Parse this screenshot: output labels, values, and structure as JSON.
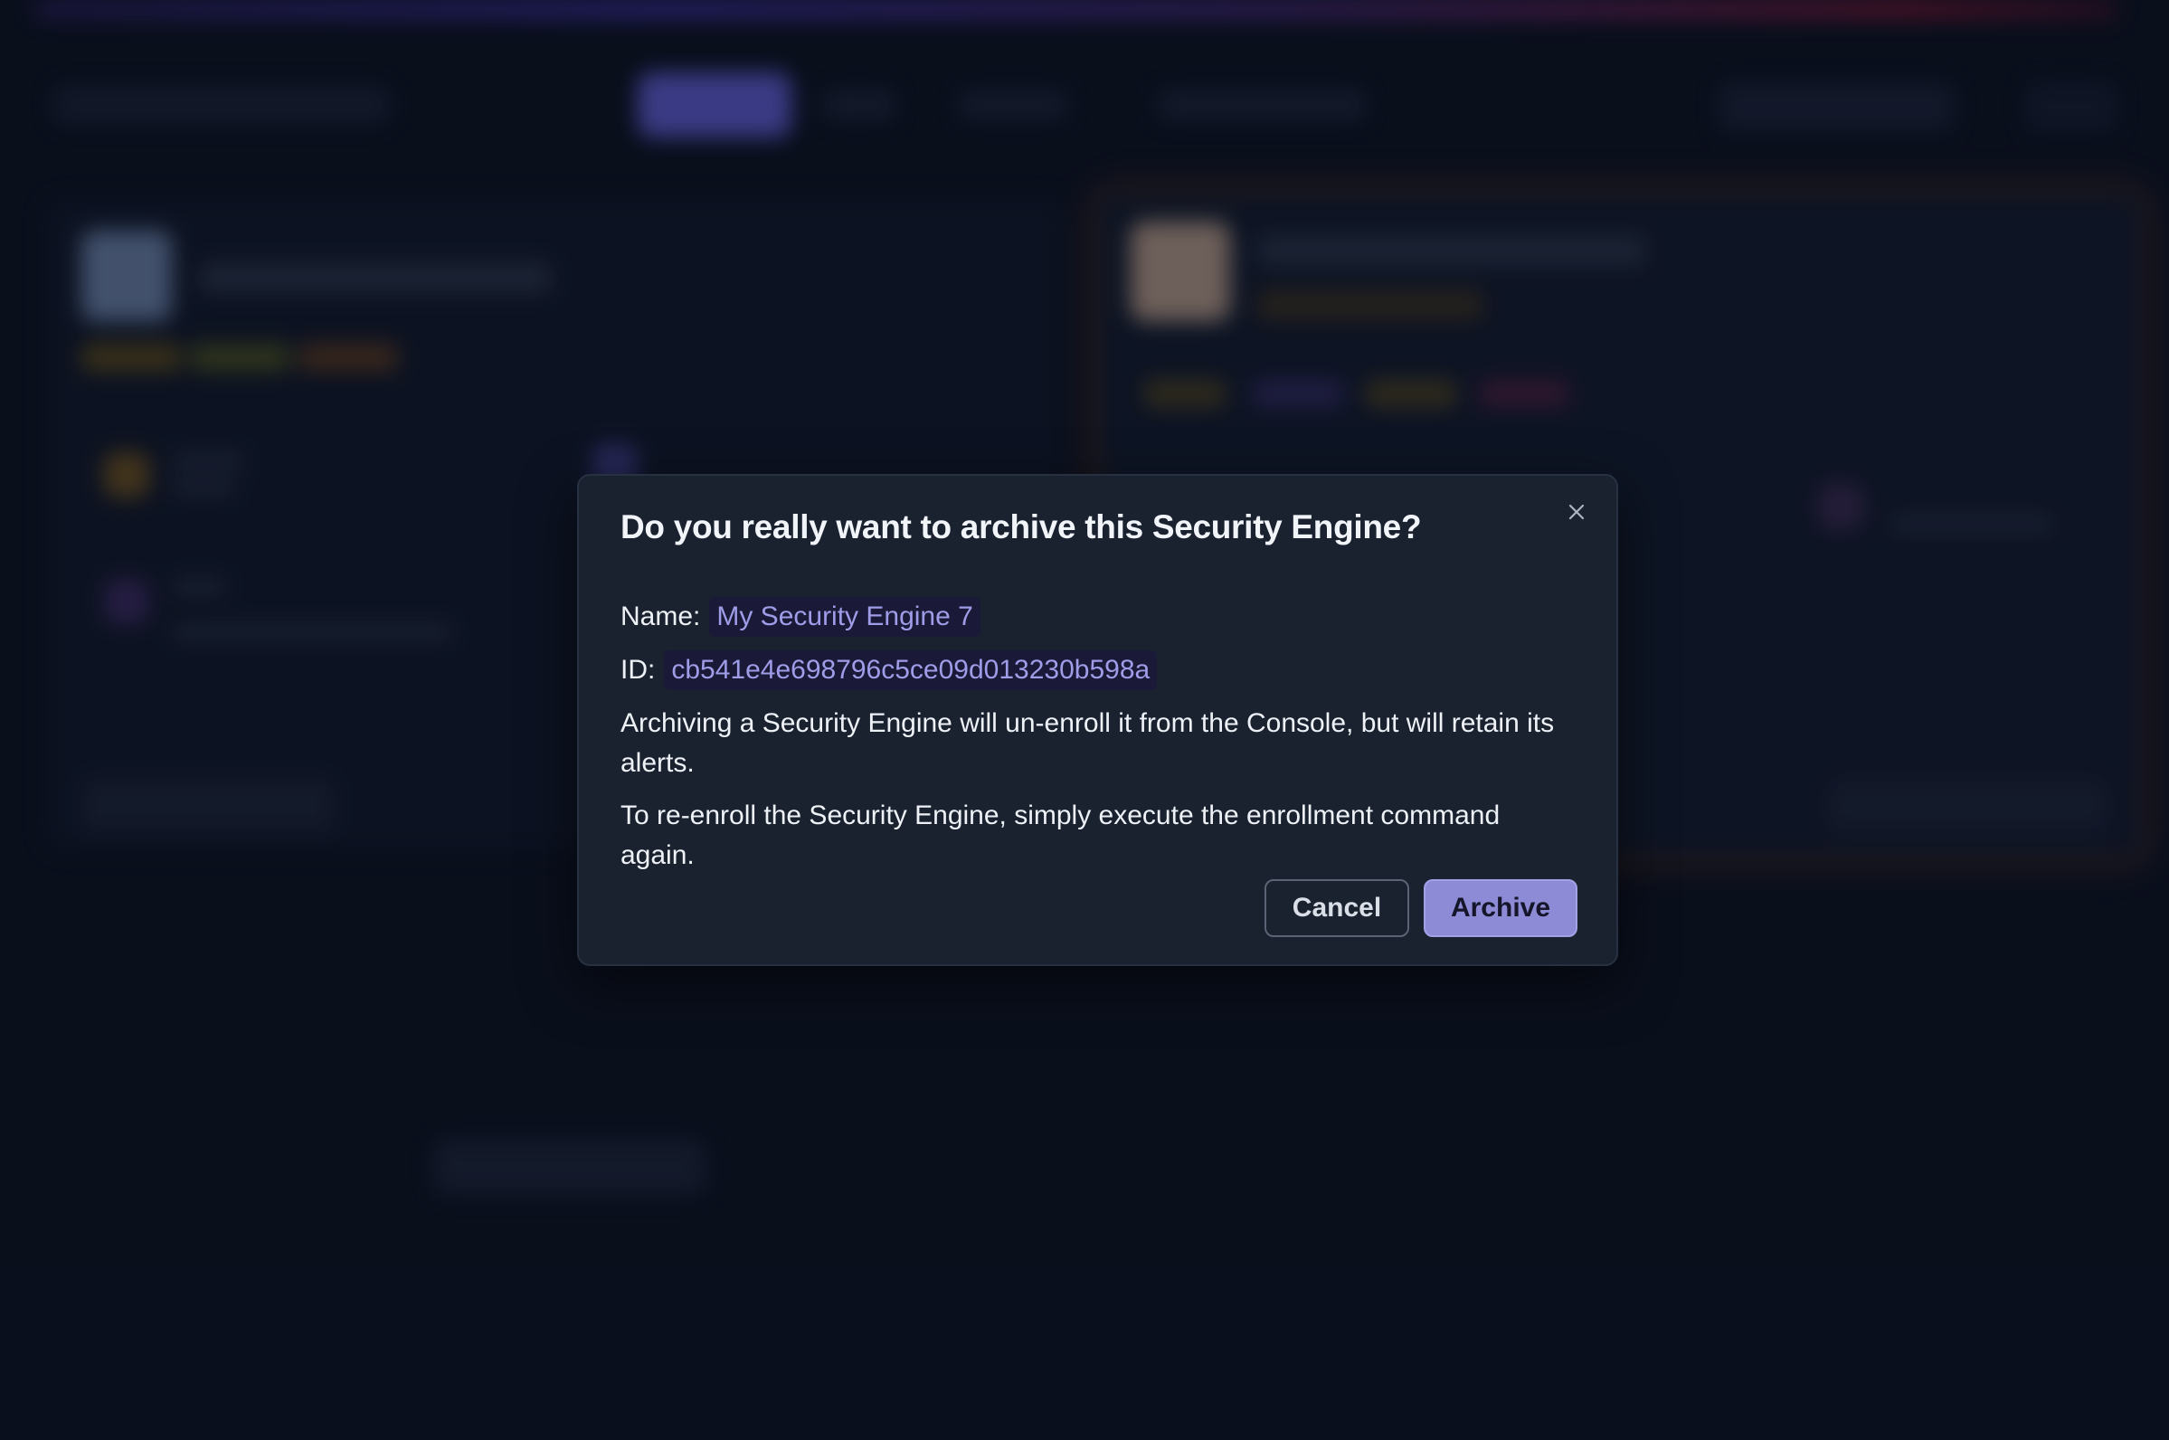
{
  "dialog": {
    "title": "Do you really want to archive this Security Engine?",
    "name_label": "Name:",
    "name_value": "My Security Engine 7",
    "id_label": "ID:",
    "id_value": "cb541e4e698796c5ce09d013230b598a",
    "paragraph_1": "Archiving a Security Engine will un-enroll it from the Console, but will retain its alerts.",
    "paragraph_2": "To re-enroll the Security Engine, simply execute the enrollment command again.",
    "cancel_label": "Cancel",
    "archive_label": "Archive",
    "close_icon": "close-icon"
  },
  "colors": {
    "background": "#0b1120",
    "dialog_bg": "#1a2230",
    "chip_bg": "#1a1a38",
    "chip_text": "#9f9ce8",
    "accent": "#8d8bd6"
  }
}
